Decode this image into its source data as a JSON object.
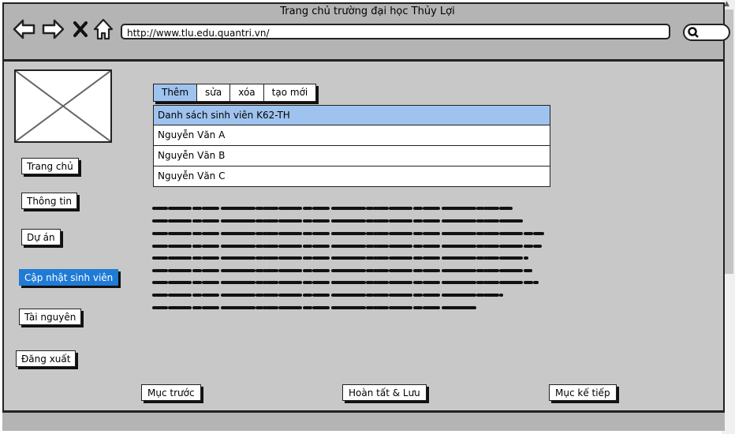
{
  "window": {
    "title": "Trang chủ trường đại học Thủy Lợi"
  },
  "browser": {
    "url": "http://www.tlu.edu.quantri.vn/"
  },
  "sidebar": {
    "items": [
      {
        "label": "Trang chủ",
        "active": false
      },
      {
        "label": "Thông tin",
        "active": false
      },
      {
        "label": "Dự án",
        "active": false
      },
      {
        "label": "Cập nhật sinh viên",
        "active": true
      },
      {
        "label": "Tài nguyên",
        "active": false
      },
      {
        "label": "Đăng xuất",
        "active": false
      }
    ]
  },
  "main": {
    "tabs": [
      {
        "label": "Thêm",
        "selected": true
      },
      {
        "label": "sửa",
        "selected": false
      },
      {
        "label": "xóa",
        "selected": false
      },
      {
        "label": "tạo mới",
        "selected": false
      }
    ],
    "list": {
      "header": "Danh sách sinh viên K62-TH",
      "items": [
        "Nguyễn Văn A",
        "Nguyễn Văn B",
        "Nguyễn Văn C"
      ]
    }
  },
  "footer": {
    "prev_label": "Mục trước",
    "save_label": "Hoàn tất & Lưu",
    "next_label": "Mục kế tiếp"
  },
  "colors": {
    "accent": "#1f7bd6",
    "selected_bg": "#9fc3ef",
    "frame_bg": "#c8c8c8",
    "bar_bg": "#b4b4b4"
  },
  "icons": [
    "back-arrow-icon",
    "forward-arrow-icon",
    "close-icon",
    "home-icon",
    "search-icon",
    "image-placeholder-icon"
  ]
}
